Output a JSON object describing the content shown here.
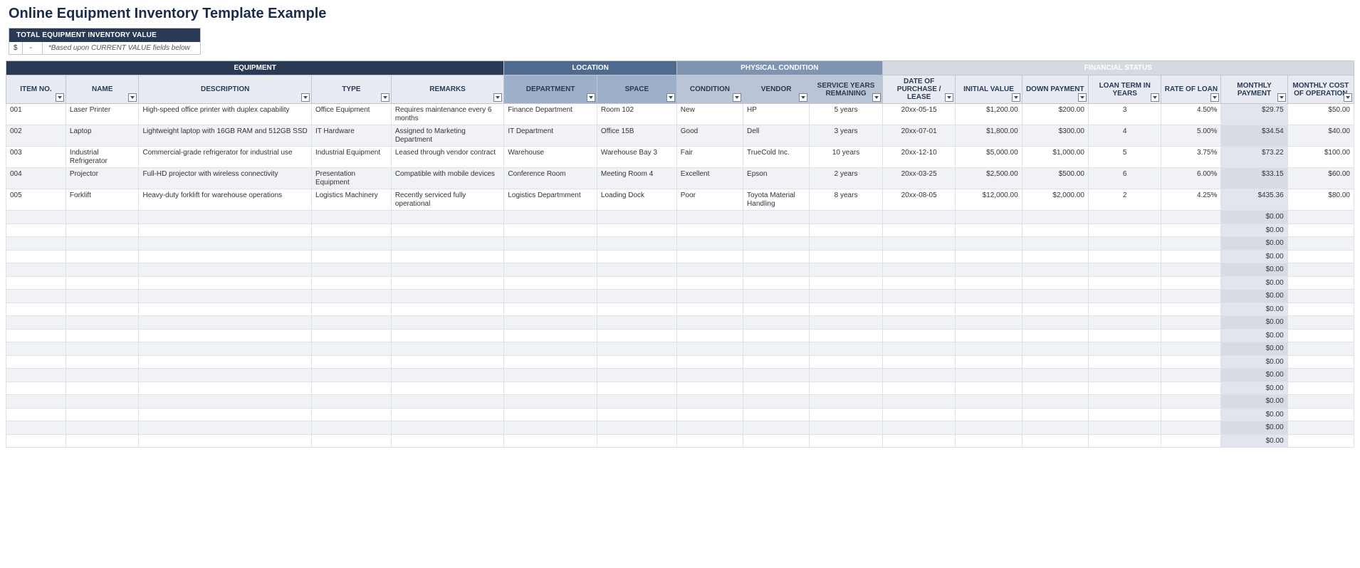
{
  "title": "Online Equipment Inventory Template Example",
  "total": {
    "header": "TOTAL EQUIPMENT INVENTORY VALUE",
    "currency": "$",
    "value": "-",
    "note": "*Based upon CURRENT VALUE fields below"
  },
  "groups": {
    "equipment": "EQUIPMENT",
    "location": "LOCATION",
    "physical": "PHYSICAL CONDITION",
    "financial": "FINANCIAL STATUS"
  },
  "columns": {
    "itemno": "ITEM NO.",
    "name": "NAME",
    "desc": "DESCRIPTION",
    "type": "TYPE",
    "remarks": "REMARKS",
    "dept": "DEPARTMENT",
    "space": "SPACE",
    "cond": "CONDITION",
    "vendor": "VENDOR",
    "svcyrs": "SERVICE YEARS REMAINING",
    "dop": "DATE OF PURCHASE / LEASE",
    "inval": "INITIAL VALUE",
    "down": "DOWN PAYMENT",
    "lterm": "LOAN TERM IN YEARS",
    "rate": "RATE OF LOAN",
    "mpay": "MONTHLY PAYMENT",
    "mcost": "MONTHLY COST OF OPERATION"
  },
  "rows": [
    {
      "itemno": "001",
      "name": "Laser Printer",
      "desc": "High-speed office printer with duplex capability",
      "type": "Office Equipment",
      "remarks": "Requires maintenance every 6 months",
      "dept": "Finance Department",
      "space": "Room 102",
      "cond": "New",
      "vendor": "HP",
      "svcyrs": "5 years",
      "dop": "20xx-05-15",
      "inval": "$1,200.00",
      "down": "$200.00",
      "lterm": "3",
      "rate": "4.50%",
      "mpay": "$29.75",
      "mcost": "$50.00"
    },
    {
      "itemno": "002",
      "name": "Laptop",
      "desc": "Lightweight laptop with 16GB RAM and 512GB SSD",
      "type": "IT Hardware",
      "remarks": "Assigned to Marketing Department",
      "dept": "IT Department",
      "space": "Office 15B",
      "cond": "Good",
      "vendor": "Dell",
      "svcyrs": "3 years",
      "dop": "20xx-07-01",
      "inval": "$1,800.00",
      "down": "$300.00",
      "lterm": "4",
      "rate": "5.00%",
      "mpay": "$34.54",
      "mcost": "$40.00"
    },
    {
      "itemno": "003",
      "name": "Industrial Refrigerator",
      "desc": "Commercial-grade refrigerator for industrial use",
      "type": "Industrial Equipment",
      "remarks": "Leased through vendor contract",
      "dept": "Warehouse",
      "space": "Warehouse Bay 3",
      "cond": "Fair",
      "vendor": "TrueCold Inc.",
      "svcyrs": "10 years",
      "dop": "20xx-12-10",
      "inval": "$5,000.00",
      "down": "$1,000.00",
      "lterm": "5",
      "rate": "3.75%",
      "mpay": "$73.22",
      "mcost": "$100.00"
    },
    {
      "itemno": "004",
      "name": "Projector",
      "desc": "Full-HD projector with wireless connectivity",
      "type": "Presentation Equipment",
      "remarks": "Compatible with mobile devices",
      "dept": "Conference Room",
      "space": "Meeting Room 4",
      "cond": "Excellent",
      "vendor": "Epson",
      "svcyrs": "2 years",
      "dop": "20xx-03-25",
      "inval": "$2,500.00",
      "down": "$500.00",
      "lterm": "6",
      "rate": "6.00%",
      "mpay": "$33.15",
      "mcost": "$60.00"
    },
    {
      "itemno": "005",
      "name": "Forklift",
      "desc": "Heavy-duty forklift for warehouse operations",
      "type": "Logistics Machinery",
      "remarks": "Recently serviced fully operational",
      "dept": "Logistics Departmment",
      "space": "Loading Dock",
      "cond": "Poor",
      "vendor": "Toyota Material Handling",
      "svcyrs": "8 years",
      "dop": "20xx-08-05",
      "inval": "$12,000.00",
      "down": "$2,000.00",
      "lterm": "2",
      "rate": "4.25%",
      "mpay": "$435.36",
      "mcost": "$80.00"
    }
  ],
  "empty_row": {
    "mpay": "$0.00"
  },
  "empty_row_count": 18
}
